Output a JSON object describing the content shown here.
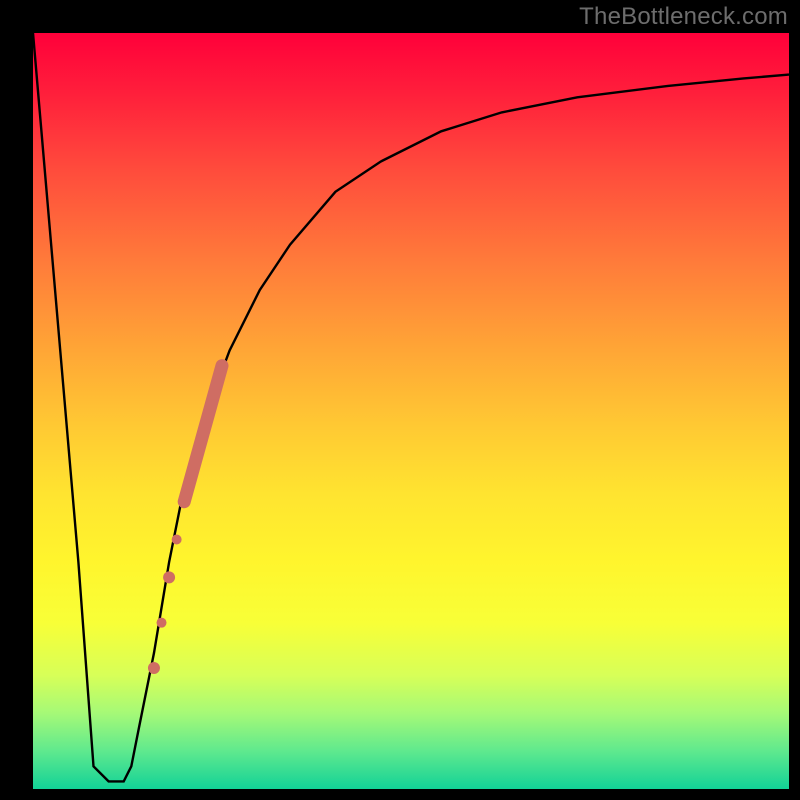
{
  "watermark": "TheBottleneck.com",
  "colors": {
    "frame": "#000000",
    "curve": "#000000",
    "marker": "#cf6d63",
    "gradient_stops": [
      "#ff003a",
      "#ff1f3b",
      "#ff4b3c",
      "#ff7a3a",
      "#ffa636",
      "#ffc933",
      "#ffe430",
      "#fff52d",
      "#f8ff37",
      "#d7ff58",
      "#a5f977",
      "#5fe98e",
      "#12d297"
    ]
  },
  "chart_data": {
    "type": "line",
    "title": "",
    "xlabel": "",
    "ylabel": "",
    "xlim": [
      0,
      100
    ],
    "ylim": [
      0,
      100
    ],
    "series": [
      {
        "name": "bottleneck-curve",
        "x": [
          0,
          6,
          8,
          10,
          12,
          13,
          14,
          16,
          18,
          20,
          23,
          26,
          30,
          34,
          40,
          46,
          54,
          62,
          72,
          84,
          94,
          100
        ],
        "y": [
          100,
          30,
          3,
          1,
          1,
          3,
          8,
          18,
          30,
          40,
          50,
          58,
          66,
          72,
          79,
          83,
          87,
          89.5,
          91.5,
          93,
          94,
          94.5
        ]
      }
    ],
    "markers": {
      "name": "highlight-segment",
      "points": [
        {
          "x": 16.0,
          "y": 16,
          "r": 6
        },
        {
          "x": 17.0,
          "y": 22,
          "r": 5
        },
        {
          "x": 18.0,
          "y": 28,
          "r": 6
        },
        {
          "x": 19.0,
          "y": 33,
          "r": 5
        }
      ],
      "thick_segment": {
        "x1": 20.0,
        "y1": 38,
        "x2": 25.0,
        "y2": 56,
        "width": 13
      }
    }
  }
}
